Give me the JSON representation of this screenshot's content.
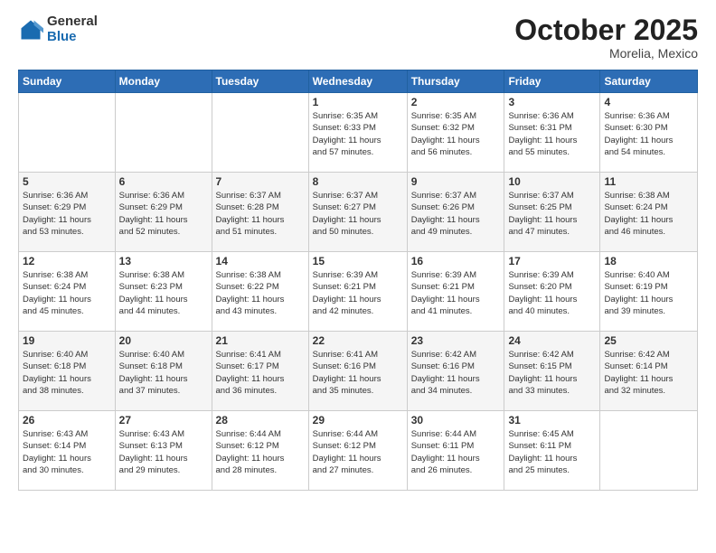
{
  "logo": {
    "general": "General",
    "blue": "Blue"
  },
  "header": {
    "month": "October 2025",
    "location": "Morelia, Mexico"
  },
  "weekdays": [
    "Sunday",
    "Monday",
    "Tuesday",
    "Wednesday",
    "Thursday",
    "Friday",
    "Saturday"
  ],
  "weeks": [
    [
      {
        "day": "",
        "info": ""
      },
      {
        "day": "",
        "info": ""
      },
      {
        "day": "",
        "info": ""
      },
      {
        "day": "1",
        "info": "Sunrise: 6:35 AM\nSunset: 6:33 PM\nDaylight: 11 hours\nand 57 minutes."
      },
      {
        "day": "2",
        "info": "Sunrise: 6:35 AM\nSunset: 6:32 PM\nDaylight: 11 hours\nand 56 minutes."
      },
      {
        "day": "3",
        "info": "Sunrise: 6:36 AM\nSunset: 6:31 PM\nDaylight: 11 hours\nand 55 minutes."
      },
      {
        "day": "4",
        "info": "Sunrise: 6:36 AM\nSunset: 6:30 PM\nDaylight: 11 hours\nand 54 minutes."
      }
    ],
    [
      {
        "day": "5",
        "info": "Sunrise: 6:36 AM\nSunset: 6:29 PM\nDaylight: 11 hours\nand 53 minutes."
      },
      {
        "day": "6",
        "info": "Sunrise: 6:36 AM\nSunset: 6:29 PM\nDaylight: 11 hours\nand 52 minutes."
      },
      {
        "day": "7",
        "info": "Sunrise: 6:37 AM\nSunset: 6:28 PM\nDaylight: 11 hours\nand 51 minutes."
      },
      {
        "day": "8",
        "info": "Sunrise: 6:37 AM\nSunset: 6:27 PM\nDaylight: 11 hours\nand 50 minutes."
      },
      {
        "day": "9",
        "info": "Sunrise: 6:37 AM\nSunset: 6:26 PM\nDaylight: 11 hours\nand 49 minutes."
      },
      {
        "day": "10",
        "info": "Sunrise: 6:37 AM\nSunset: 6:25 PM\nDaylight: 11 hours\nand 47 minutes."
      },
      {
        "day": "11",
        "info": "Sunrise: 6:38 AM\nSunset: 6:24 PM\nDaylight: 11 hours\nand 46 minutes."
      }
    ],
    [
      {
        "day": "12",
        "info": "Sunrise: 6:38 AM\nSunset: 6:24 PM\nDaylight: 11 hours\nand 45 minutes."
      },
      {
        "day": "13",
        "info": "Sunrise: 6:38 AM\nSunset: 6:23 PM\nDaylight: 11 hours\nand 44 minutes."
      },
      {
        "day": "14",
        "info": "Sunrise: 6:38 AM\nSunset: 6:22 PM\nDaylight: 11 hours\nand 43 minutes."
      },
      {
        "day": "15",
        "info": "Sunrise: 6:39 AM\nSunset: 6:21 PM\nDaylight: 11 hours\nand 42 minutes."
      },
      {
        "day": "16",
        "info": "Sunrise: 6:39 AM\nSunset: 6:21 PM\nDaylight: 11 hours\nand 41 minutes."
      },
      {
        "day": "17",
        "info": "Sunrise: 6:39 AM\nSunset: 6:20 PM\nDaylight: 11 hours\nand 40 minutes."
      },
      {
        "day": "18",
        "info": "Sunrise: 6:40 AM\nSunset: 6:19 PM\nDaylight: 11 hours\nand 39 minutes."
      }
    ],
    [
      {
        "day": "19",
        "info": "Sunrise: 6:40 AM\nSunset: 6:18 PM\nDaylight: 11 hours\nand 38 minutes."
      },
      {
        "day": "20",
        "info": "Sunrise: 6:40 AM\nSunset: 6:18 PM\nDaylight: 11 hours\nand 37 minutes."
      },
      {
        "day": "21",
        "info": "Sunrise: 6:41 AM\nSunset: 6:17 PM\nDaylight: 11 hours\nand 36 minutes."
      },
      {
        "day": "22",
        "info": "Sunrise: 6:41 AM\nSunset: 6:16 PM\nDaylight: 11 hours\nand 35 minutes."
      },
      {
        "day": "23",
        "info": "Sunrise: 6:42 AM\nSunset: 6:16 PM\nDaylight: 11 hours\nand 34 minutes."
      },
      {
        "day": "24",
        "info": "Sunrise: 6:42 AM\nSunset: 6:15 PM\nDaylight: 11 hours\nand 33 minutes."
      },
      {
        "day": "25",
        "info": "Sunrise: 6:42 AM\nSunset: 6:14 PM\nDaylight: 11 hours\nand 32 minutes."
      }
    ],
    [
      {
        "day": "26",
        "info": "Sunrise: 6:43 AM\nSunset: 6:14 PM\nDaylight: 11 hours\nand 30 minutes."
      },
      {
        "day": "27",
        "info": "Sunrise: 6:43 AM\nSunset: 6:13 PM\nDaylight: 11 hours\nand 29 minutes."
      },
      {
        "day": "28",
        "info": "Sunrise: 6:44 AM\nSunset: 6:12 PM\nDaylight: 11 hours\nand 28 minutes."
      },
      {
        "day": "29",
        "info": "Sunrise: 6:44 AM\nSunset: 6:12 PM\nDaylight: 11 hours\nand 27 minutes."
      },
      {
        "day": "30",
        "info": "Sunrise: 6:44 AM\nSunset: 6:11 PM\nDaylight: 11 hours\nand 26 minutes."
      },
      {
        "day": "31",
        "info": "Sunrise: 6:45 AM\nSunset: 6:11 PM\nDaylight: 11 hours\nand 25 minutes."
      },
      {
        "day": "",
        "info": ""
      }
    ]
  ]
}
